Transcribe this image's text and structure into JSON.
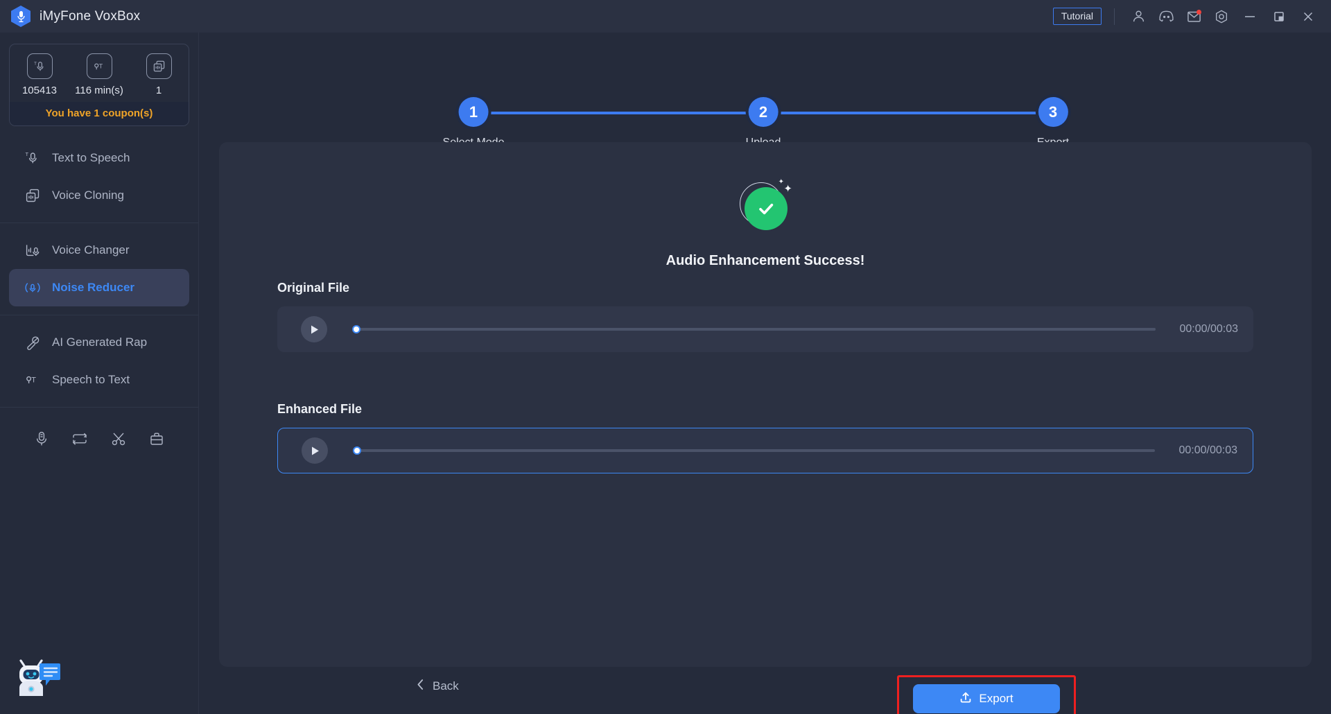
{
  "window": {
    "app_title": "iMyFone VoxBox",
    "logo_icon": "microphone-hex-logo",
    "tutorial_label": "Tutorial",
    "titlebar_icons": [
      "account-icon",
      "discord-icon",
      "mail-icon",
      "settings-gear-icon"
    ],
    "controls": [
      "minimize-icon",
      "restore-icon",
      "close-icon"
    ]
  },
  "sidebar": {
    "credits": {
      "cells": [
        {
          "icon": "text-to-speech-icon",
          "value": "105413"
        },
        {
          "icon": "speech-to-text-icon",
          "value": "116 min(s)"
        },
        {
          "icon": "voice-cloning-icon",
          "value": "1"
        }
      ],
      "coupon_text": "You have 1 coupon(s)"
    },
    "items": [
      {
        "label": "Text to Speech",
        "icon": "text-to-speech-icon",
        "active": false
      },
      {
        "label": "Voice Cloning",
        "icon": "voice-cloning-icon",
        "active": false
      },
      {
        "label": "Voice Changer",
        "icon": "voice-changer-icon",
        "active": false
      },
      {
        "label": "Noise Reducer",
        "icon": "noise-reducer-icon",
        "active": true
      },
      {
        "label": "AI Generated Rap",
        "icon": "ai-rap-icon",
        "active": false
      },
      {
        "label": "Speech to Text",
        "icon": "speech-to-text-icon",
        "active": false
      }
    ],
    "tools": [
      "audio-recorder-icon",
      "audio-converter-icon",
      "audio-cutter-icon",
      "toolbox-icon"
    ],
    "chatbot_icon": "chatbot-icon"
  },
  "main": {
    "steps": [
      {
        "number": "1",
        "label": "Select Mode"
      },
      {
        "number": "2",
        "label": "Upload"
      },
      {
        "number": "3",
        "label": "Export"
      }
    ],
    "success": {
      "icon": "success-check-icon",
      "message": "Audio Enhancement Success!"
    },
    "files": [
      {
        "label": "Original File",
        "play_icon": "play-icon",
        "time": "00:00/00:03",
        "progress": 0,
        "highlighted": false
      },
      {
        "label": "Enhanced File",
        "play_icon": "play-icon",
        "time": "00:00/00:03",
        "progress": 0,
        "highlighted": true
      }
    ],
    "footer": {
      "back_label": "Back",
      "back_icon": "chevron-left-icon",
      "export_label": "Export",
      "export_icon": "upload-icon"
    }
  },
  "colors": {
    "accent_blue": "#3d88f5",
    "step_blue": "#3d7bf0",
    "success_green": "#23c571",
    "coupon_orange": "#f0a428",
    "highlight_red": "#ee2020",
    "panel_bg": "#2b3142",
    "app_bg": "#252b3b"
  }
}
